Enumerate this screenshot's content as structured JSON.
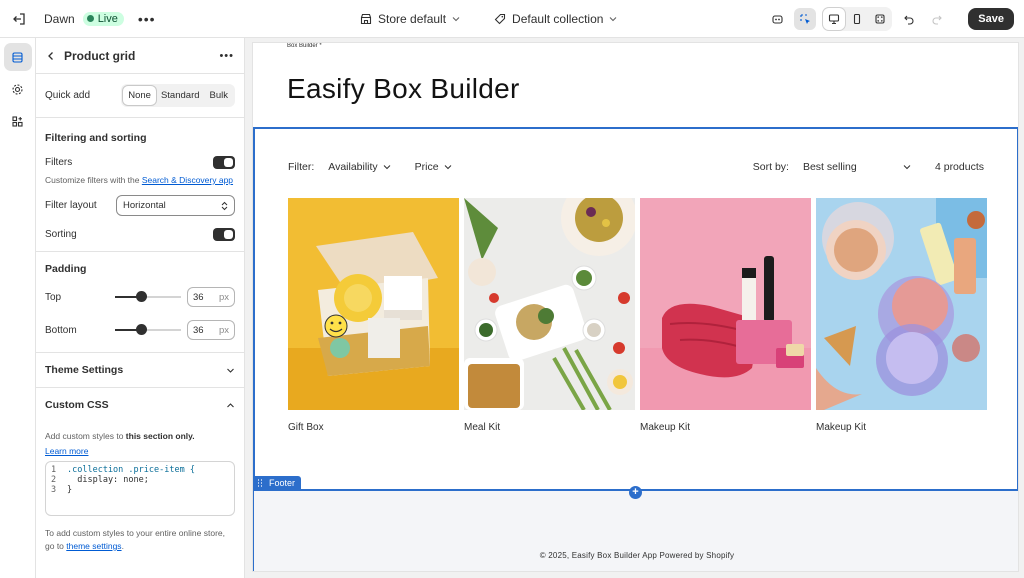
{
  "topbar": {
    "theme_name": "Dawn",
    "status": "Live",
    "store_label": "Store default",
    "template_label": "Default collection",
    "save_label": "Save"
  },
  "panel": {
    "title": "Product grid",
    "quick_add": {
      "label": "Quick add",
      "options": [
        "None",
        "Standard",
        "Bulk"
      ],
      "selected": "None"
    },
    "filtering": {
      "heading": "Filtering and sorting",
      "filters_label": "Filters",
      "filters_on": true,
      "help_prefix": "Customize filters with the ",
      "help_link": "Search & Discovery app",
      "layout_label": "Filter layout",
      "layout_value": "Horizontal",
      "sorting_label": "Sorting",
      "sorting_on": true
    },
    "padding": {
      "heading": "Padding",
      "top_label": "Top",
      "top_value": "36",
      "bottom_label": "Bottom",
      "bottom_value": "36",
      "unit": "px",
      "slider_fraction": 0.38
    },
    "theme_settings": "Theme Settings",
    "custom_css": {
      "heading": "Custom CSS",
      "help_prefix": "Add custom styles to ",
      "help_bold": "this section only.",
      "learn_more": "Learn more",
      "code": [
        {
          "n": "1",
          "text": ".collection .price-item {"
        },
        {
          "n": "2",
          "text": "  display: none;"
        },
        {
          "n": "3",
          "text": "}"
        }
      ],
      "footer_prefix": "To add custom styles to your entire online store, go to ",
      "footer_link": "theme settings",
      "footer_suffix": "."
    }
  },
  "preview": {
    "breadcrumb": "Box Builder *",
    "page_title": "Easify Box Builder",
    "filter_label": "Filter:",
    "filters": [
      "Availability",
      "Price"
    ],
    "sort_label": "Sort by:",
    "sort_value": "Best selling",
    "product_count": "4 products",
    "products": [
      {
        "name": "Gift Box"
      },
      {
        "name": "Meal Kit"
      },
      {
        "name": "Makeup Kit"
      },
      {
        "name": "Makeup Kit"
      }
    ],
    "footer_tag": "Footer",
    "copyright": "© 2025, Easify Box Builder App Powered by Shopify"
  }
}
